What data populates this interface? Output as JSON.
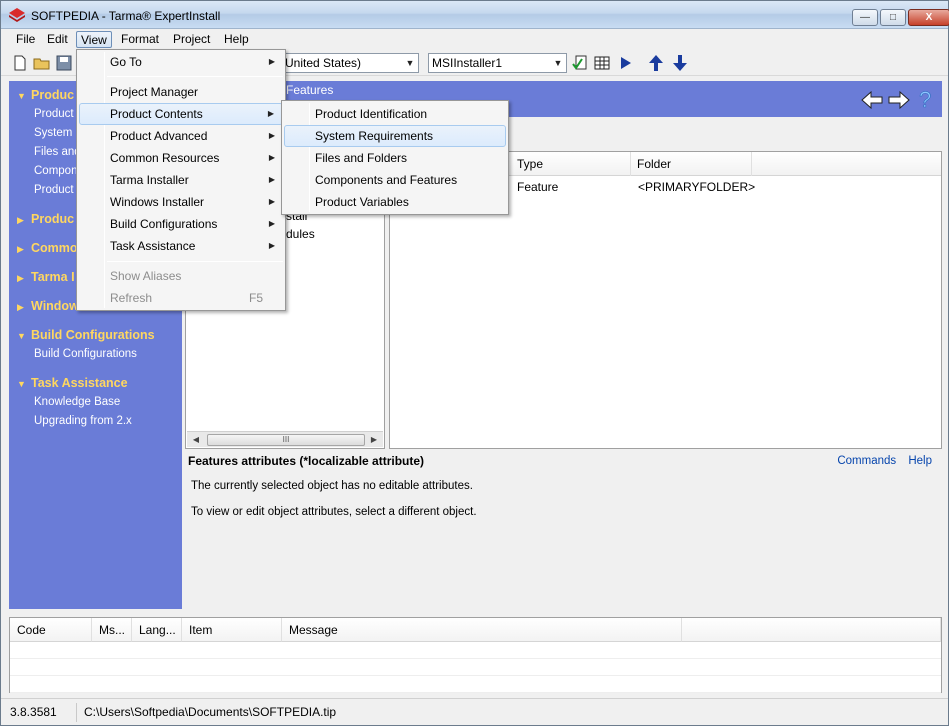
{
  "window": {
    "title_brand": "SOFTPEDIA",
    "title": " - Tarma® ExpertInstall",
    "controls": {
      "minimize": "—",
      "maximize": "□",
      "close": "X"
    }
  },
  "menubar": {
    "items": [
      "File",
      "Edit",
      "View",
      "Format",
      "Project",
      "Help"
    ],
    "active": "View"
  },
  "toolbar": {
    "language_combo": "United States)",
    "target_combo": "MSIInstaller1"
  },
  "sidebar": {
    "sections": [
      {
        "header": "Produc",
        "items": [
          "Product",
          "System R",
          "Files and",
          "Compone",
          "Product V"
        ]
      },
      {
        "header": "Produc",
        "items": []
      },
      {
        "header": "Commo",
        "items": []
      },
      {
        "header": "Tarma I",
        "items": []
      },
      {
        "header": "Window",
        "items": []
      },
      {
        "header": "Build Configurations",
        "items": [
          "Build Configurations"
        ]
      },
      {
        "header": "Task Assistance",
        "items": [
          "Knowledge Base",
          "Upgrading from 2.x"
        ]
      }
    ]
  },
  "banner": {
    "title": "Features"
  },
  "tree": {
    "lines": [
      "stall",
      "dules"
    ],
    "scroll_grip": "III"
  },
  "grid": {
    "columns": [
      "Type",
      "Folder"
    ],
    "rows": [
      {
        "type": "Feature",
        "folder": "<PRIMARYFOLDER>"
      }
    ]
  },
  "attributes": {
    "title": "Features attributes (*localizable attribute)",
    "links": [
      "Commands",
      "Help"
    ],
    "line1": "The currently selected object has no editable attributes.",
    "line2": "To view or edit object attributes, select a different object."
  },
  "log": {
    "columns": [
      "Code",
      "Ms...",
      "Lang...",
      "Item",
      "Message"
    ]
  },
  "status": {
    "version": "3.8.3581",
    "path": "C:\\Users\\Softpedia\\Documents\\SOFTPEDIA.tip"
  },
  "view_menu": {
    "items": [
      {
        "label": "Go To",
        "submenu": true
      },
      {
        "label": "Project Manager"
      },
      {
        "label": "Product Contents",
        "submenu": true,
        "highlighted": true
      },
      {
        "label": "Product Advanced",
        "submenu": true
      },
      {
        "label": "Common Resources",
        "submenu": true
      },
      {
        "label": "Tarma Installer",
        "submenu": true
      },
      {
        "label": "Windows Installer",
        "submenu": true
      },
      {
        "label": "Build Configurations",
        "submenu": true
      },
      {
        "label": "Task Assistance",
        "submenu": true
      },
      {
        "label": "Show Aliases",
        "disabled": true
      },
      {
        "label": "Refresh",
        "disabled": true,
        "shortcut": "F5"
      }
    ]
  },
  "submenu": {
    "items": [
      {
        "label": "Product Identification"
      },
      {
        "label": "System Requirements",
        "highlighted": true
      },
      {
        "label": "Files and Folders"
      },
      {
        "label": "Components and Features"
      },
      {
        "label": "Product Variables"
      }
    ]
  },
  "colors": {
    "sidebar_bg": "#6a7cd7",
    "sidebar_header": "#ffd760",
    "link": "#0645ad"
  },
  "icons": [
    "app-logo-icon",
    "new-document-icon",
    "open-folder-icon",
    "save-icon",
    "build-icon",
    "grid-icon",
    "play-icon",
    "arrow-up-icon",
    "arrow-down-icon",
    "back-arrow-icon",
    "forward-arrow-icon",
    "help-icon",
    "submenu-arrow-icon"
  ]
}
